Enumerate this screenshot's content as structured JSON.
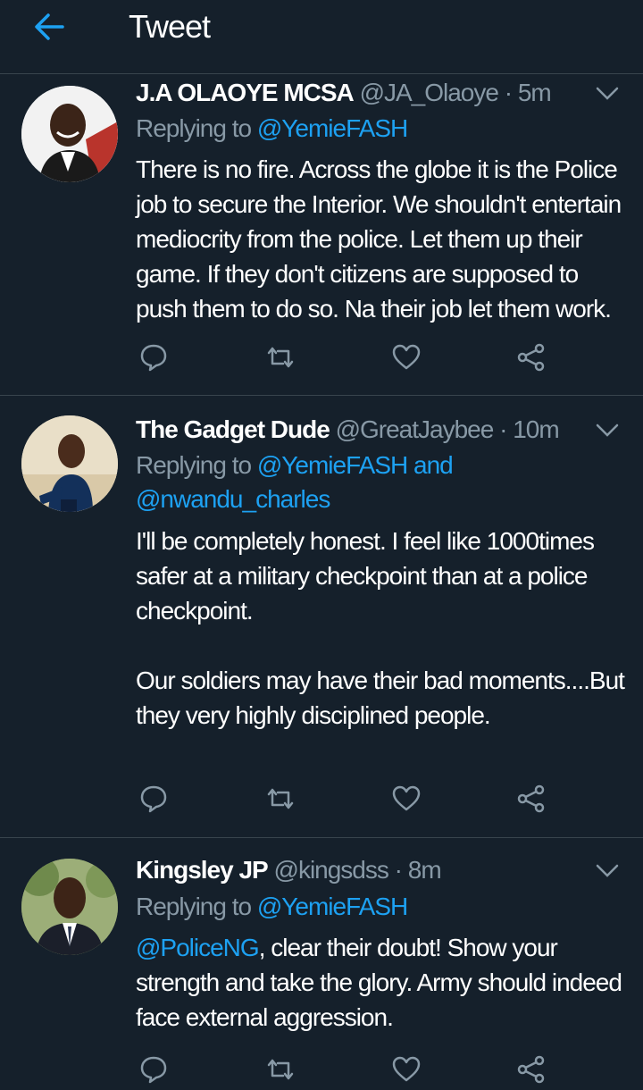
{
  "header": {
    "title": "Tweet"
  },
  "icons": {
    "back": "arrow-left-icon",
    "menu": "chevron-down-icon",
    "reply": "comment-icon",
    "retweet": "retweet-icon",
    "like": "heart-icon",
    "share": "share-icon"
  },
  "colors": {
    "background": "#15202b",
    "accent": "#1da1f2",
    "muted": "#8899a6",
    "divider": "#38444d"
  },
  "tweets": [
    {
      "name": "J.A OLAOYE MCSA",
      "handle": "@JA_Olaoye",
      "separator": "·",
      "time": "5m",
      "replying_prefix": "Replying to",
      "replying_to": "@YemieFASH",
      "text": "There is no fire. Across the globe it is the Police job to secure the Interior. We shouldn't entertain mediocrity from the police. Let them up their game. If they don't citizens are supposed to push them to do so. Na their job let them work."
    },
    {
      "name": "The Gadget Dude",
      "handle": "@GreatJaybee",
      "separator": "·",
      "time": "10m",
      "replying_prefix": "Replying to",
      "replying_to": "@YemieFASH and @nwandu_charles",
      "text": "I'll be completely honest. I feel like 1000times safer at a military checkpoint than at a police checkpoint.\n\nOur soldiers may have their bad moments....But they very highly disciplined people."
    },
    {
      "name": "Kingsley JP",
      "handle": "@kingsdss",
      "separator": "·",
      "time": "8m",
      "replying_prefix": "Replying to",
      "replying_to": "@YemieFASH",
      "mention": "@PoliceNG",
      "text": ", clear their doubt! Show your strength and take the glory. Army should indeed face external aggression."
    }
  ]
}
